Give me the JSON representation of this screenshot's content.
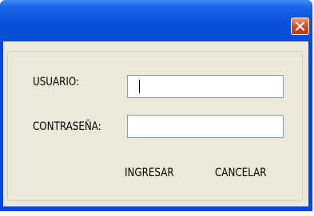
{
  "window": {
    "title": "",
    "close_icon": "close-x-icon",
    "close_color": "#d9431c",
    "titlebar_color": "#0a50dc"
  },
  "form": {
    "user_label": "USUARIO:",
    "user_value": "",
    "password_label": "CONTRASEÑA:",
    "password_value": "",
    "submit_label": "INGRESAR",
    "cancel_label": "CANCELAR"
  }
}
